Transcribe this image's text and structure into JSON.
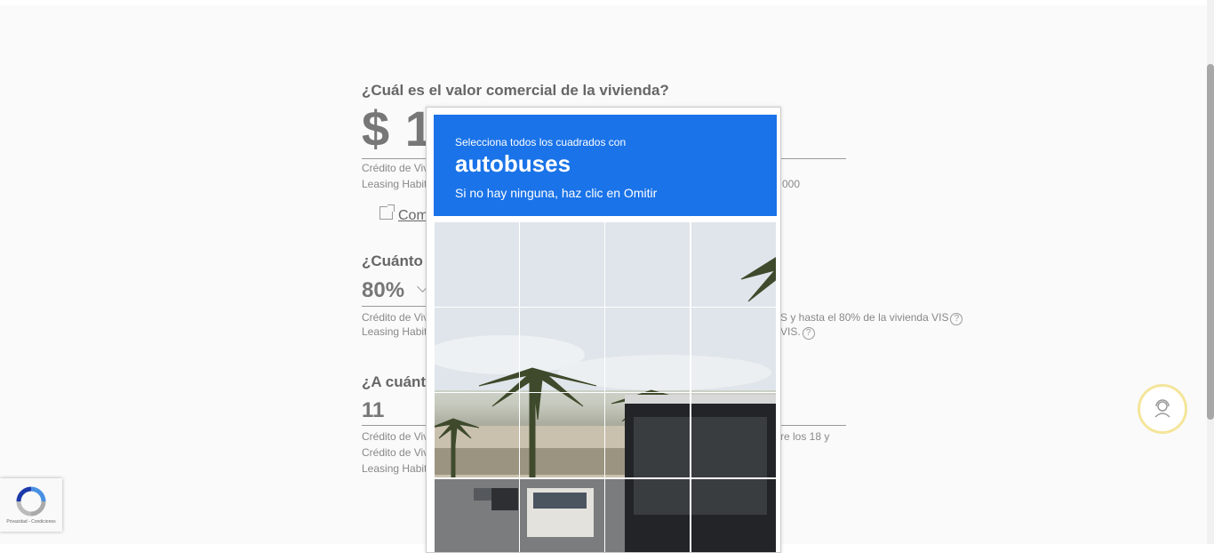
{
  "form": {
    "q1": {
      "title": "¿Cuál es el valor comercial de la vivienda?",
      "value": "$ 1",
      "note1": "Crédito de Viv",
      "note2": "Leasing Habit",
      "note2_suffix": "000"
    },
    "link_label": "Com",
    "q2": {
      "title": "¿Cuánto d",
      "value": "80%",
      "note1": "Crédito de Viv",
      "note1_suffix": "S y hasta el 80% de la vivienda VIS",
      "note2": "Leasing Habit",
      "note2_suffix": "VIS."
    },
    "q3": {
      "title": "¿A cuánto",
      "value": "11",
      "note1": "Crédito de Viv",
      "note1_suffix": "re los 18 y",
      "note2": "Crédito de Viv",
      "note3": "Leasing Habit"
    }
  },
  "captcha": {
    "instruction": "Selecciona todos los cuadrados con",
    "target": "autobuses",
    "subtext": "Si no hay ninguna, haz clic en Omitir",
    "grid_rows": 4,
    "grid_cols": 4,
    "header_color": "#1a73e8"
  },
  "recaptcha_badge": {
    "text": "Privacidad - Condiciones"
  },
  "help_symbol": "?",
  "icons": {
    "support": "support-agent-icon",
    "recaptcha": "recaptcha-logo-icon",
    "external_link": "external-link-icon"
  }
}
